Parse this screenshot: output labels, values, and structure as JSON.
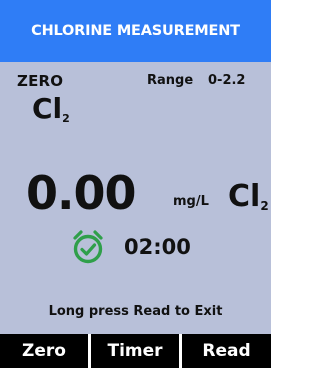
{
  "header": {
    "title": "CHLORINE MEASUREMENT"
  },
  "status": {
    "mode": "ZERO",
    "range_label": "Range",
    "range_value": "0-2.2",
    "chem_symbol": "Cl",
    "chem_subscript": "2"
  },
  "reading": {
    "value": "0.00",
    "unit": "mg/L",
    "chem_symbol": "Cl",
    "chem_subscript": "2"
  },
  "timer": {
    "value": "02:00",
    "icon": "alarm-clock-check-icon"
  },
  "hint": "Long press Read to Exit",
  "buttons": {
    "zero": "Zero",
    "timer": "Timer",
    "read": "Read"
  },
  "colors": {
    "header_bg": "#2f7df6",
    "panel_bg": "#b8c0d9",
    "button_bg": "#000000",
    "timer_icon": "#2f9f4a"
  }
}
